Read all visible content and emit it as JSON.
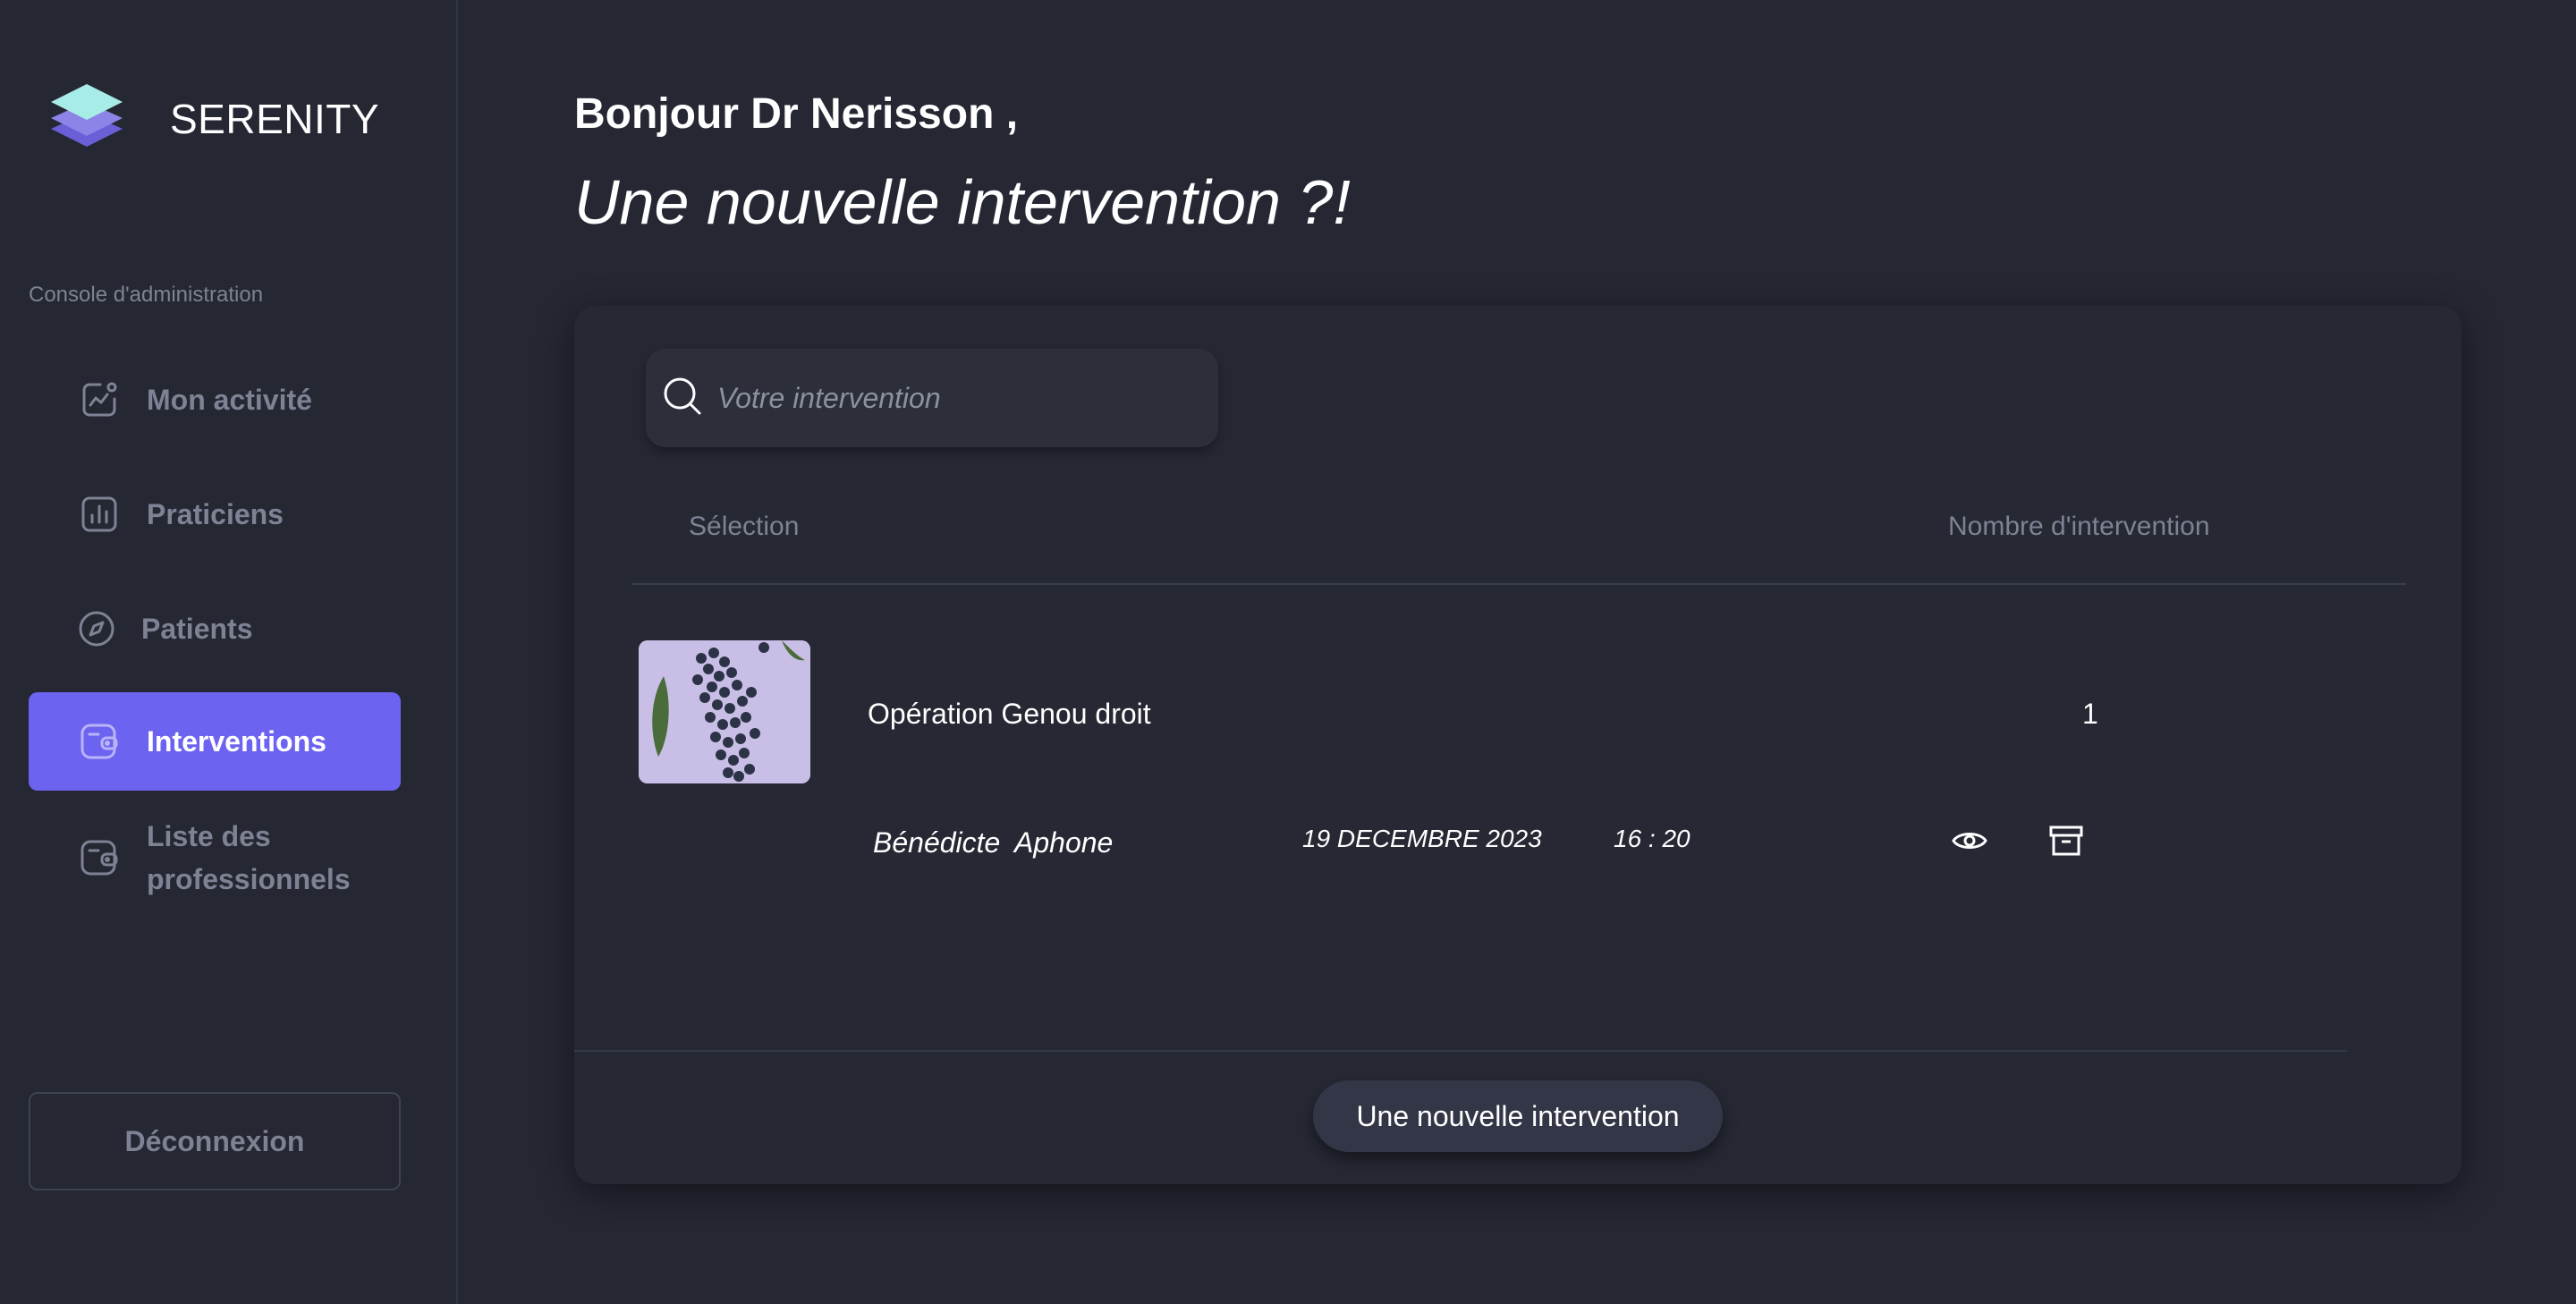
{
  "brand": {
    "name": "SERENITY",
    "icon": "layers-logo-icon"
  },
  "sidebar": {
    "section_label": "Console d'administration",
    "items": [
      {
        "label": "Mon activité",
        "icon": "activity-chart-icon",
        "active": false
      },
      {
        "label": "Praticiens",
        "icon": "bar-chart-icon",
        "active": false
      },
      {
        "label": "Patients",
        "icon": "compass-icon",
        "active": false
      },
      {
        "label": "Interventions",
        "icon": "wallet-icon",
        "active": true
      },
      {
        "label": "Liste des professionnels",
        "icon": "wallet-icon",
        "active": false
      }
    ],
    "logout_label": "Déconnexion"
  },
  "header": {
    "greeting": "Bonjour Dr Nerisson ,",
    "headline": "Une nouvelle intervention ?!"
  },
  "search": {
    "placeholder": "Votre intervention",
    "value": ""
  },
  "table": {
    "columns": [
      "Sélection",
      "Nombre d'intervention"
    ],
    "rows": [
      {
        "title": "Opération Genou droit",
        "count": "1",
        "first_name": "Bénédicte",
        "last_name": "Aphone",
        "date": "19 DECEMBRE 2023",
        "time": "16 : 20",
        "actions": [
          "eye-icon",
          "archive-icon"
        ]
      }
    ]
  },
  "actions": {
    "new_intervention_label": "Une nouvelle intervention"
  },
  "colors": {
    "background": "#252733",
    "accent": "#6c63f0",
    "muted_text": "#7f8294",
    "card": "#262834"
  }
}
